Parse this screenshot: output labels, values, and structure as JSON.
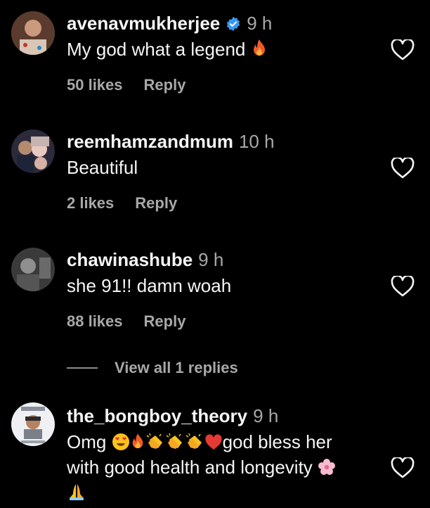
{
  "comments": [
    {
      "username": "avenavmukherjee",
      "verified": true,
      "time": "9 h",
      "text": "My god what a legend",
      "likes": "50 likes",
      "reply": "Reply"
    },
    {
      "username": "reemhamzandmum",
      "verified": false,
      "time": "10 h",
      "text": "Beautiful",
      "likes": "2 likes",
      "reply": "Reply"
    },
    {
      "username": "chawinashube",
      "verified": false,
      "time": "9 h",
      "text": "she 91!! damn woah",
      "likes": "88 likes",
      "reply": "Reply"
    },
    {
      "username": "the_bongboy_theory",
      "verified": false,
      "time": "9 h",
      "text_line1": "Omg",
      "text_line1_end": "god bless her",
      "text_line2": "with good health and longevity"
    }
  ],
  "view_replies": "View all 1 replies",
  "colors": {
    "background": "#000000",
    "primary_text": "#f5f5f5",
    "secondary_text": "#a8a8a8",
    "verified_badge": "#3897f0"
  }
}
